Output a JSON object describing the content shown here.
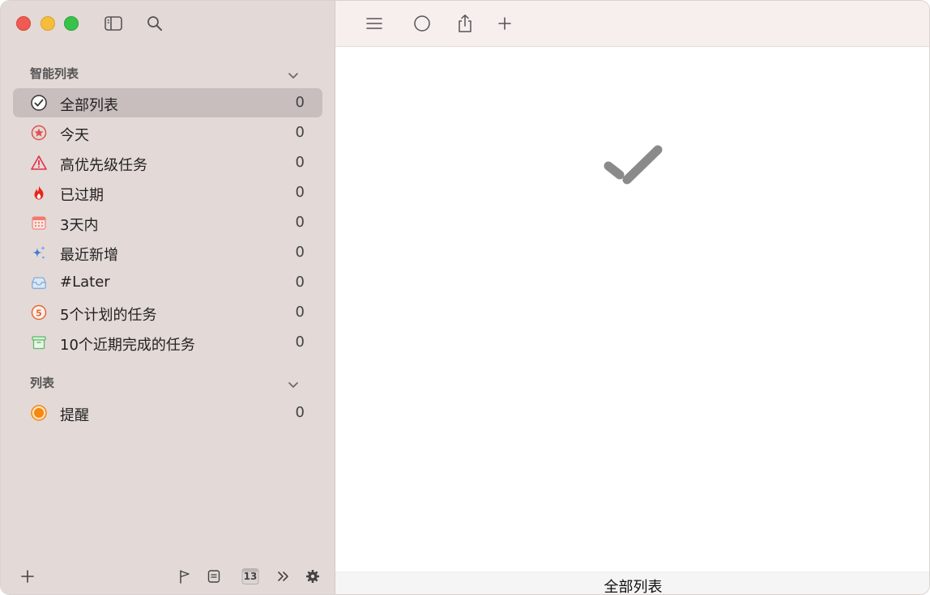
{
  "sidebar": {
    "smart_section": {
      "title": "智能列表"
    },
    "smart_lists": [
      {
        "label": "全部列表",
        "count": "0",
        "icon": "check-circle-icon",
        "selected": true
      },
      {
        "label": "今天",
        "count": "0",
        "icon": "star-circle-icon"
      },
      {
        "label": "高优先级任务",
        "count": "0",
        "icon": "warning-triangle-icon"
      },
      {
        "label": "已过期",
        "count": "0",
        "icon": "flame-icon"
      },
      {
        "label": "3天内",
        "count": "0",
        "icon": "calendar-icon"
      },
      {
        "label": "最近新增",
        "count": "0",
        "icon": "sparkles-icon"
      },
      {
        "label": "#Later",
        "count": "0",
        "icon": "tray-icon"
      },
      {
        "label": "5个计划的任务",
        "count": "0",
        "icon": "number-five-circle-icon"
      },
      {
        "label": "10个近期完成的任务",
        "count": "0",
        "icon": "archive-box-icon"
      }
    ],
    "lists_section": {
      "title": "列表"
    },
    "lists": [
      {
        "label": "提醒",
        "count": "0",
        "icon": "orange-dot-icon"
      }
    ],
    "bottom": {
      "calendar_day": "13"
    }
  },
  "main": {
    "status_title": "全部列表"
  },
  "colors": {
    "sidebar_bg": "#e3d9d7",
    "selected_bg": "#c8bebd",
    "toolbar_bg": "#f7efed",
    "accent_red": "#e0524a",
    "accent_orange": "#f5880f",
    "empty_check": "#8a8a8a"
  }
}
